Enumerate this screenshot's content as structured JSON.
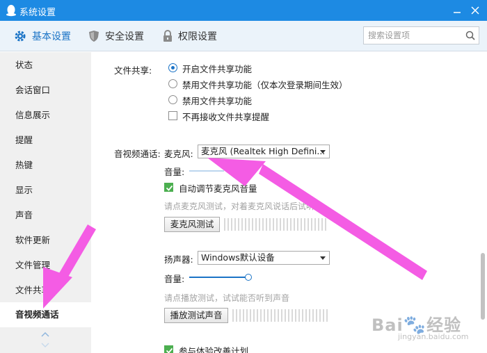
{
  "window": {
    "title": "系统设置"
  },
  "top_tabs": [
    {
      "label": "基本设置",
      "icon": "gear-icon",
      "active": true
    },
    {
      "label": "安全设置",
      "icon": "shield-icon",
      "active": false
    },
    {
      "label": "权限设置",
      "icon": "lock-icon",
      "active": false
    }
  ],
  "search": {
    "placeholder": "搜索设置项",
    "value": ""
  },
  "sidebar": {
    "items": [
      {
        "label": "状态"
      },
      {
        "label": "会话窗口"
      },
      {
        "label": "信息展示"
      },
      {
        "label": "提醒"
      },
      {
        "label": "热键"
      },
      {
        "label": "显示"
      },
      {
        "label": "声音"
      },
      {
        "label": "软件更新"
      },
      {
        "label": "文件管理"
      },
      {
        "label": "文件共享"
      },
      {
        "label": "音视频通话",
        "active": true
      }
    ]
  },
  "file_share": {
    "label": "文件共享:",
    "options": [
      {
        "label": "开启文件共享功能",
        "checked": true
      },
      {
        "label": "禁用文件共享功能（仅本次登录期间生效）",
        "checked": false
      },
      {
        "label": "禁用文件共享功能",
        "checked": false
      }
    ],
    "no_remind": {
      "label": "不再接收文件共享提醒",
      "checked": false
    }
  },
  "av_call": {
    "label": "音视频通话:",
    "mic": {
      "label": "麦克风:",
      "device": "麦克风 (Realtek High Defini...",
      "volume_label": "音量:",
      "auto_adjust": {
        "label": "自动调节麦克风音量",
        "checked": true
      },
      "test_hint": "请点麦克风测试，对着麦克风说话后试听",
      "test_button": "麦克风测试"
    },
    "speaker": {
      "label": "扬声器:",
      "device": "Windows默认设备",
      "volume_label": "音量:",
      "volume_level": 1.0,
      "test_hint": "请点播放测试，试试能否听到声音",
      "test_button": "播放测试声音"
    },
    "experience": {
      "label": "参与体验改善计划",
      "checked": true
    }
  },
  "colors": {
    "titlebar": "#1d8ae3",
    "accent": "#1a73c6",
    "annotation_arrow": "#f45ce4",
    "checkbox_green": "#4caf50"
  },
  "watermark": {
    "text": "Bai经验",
    "sub": "jingyan.baidu.com"
  }
}
